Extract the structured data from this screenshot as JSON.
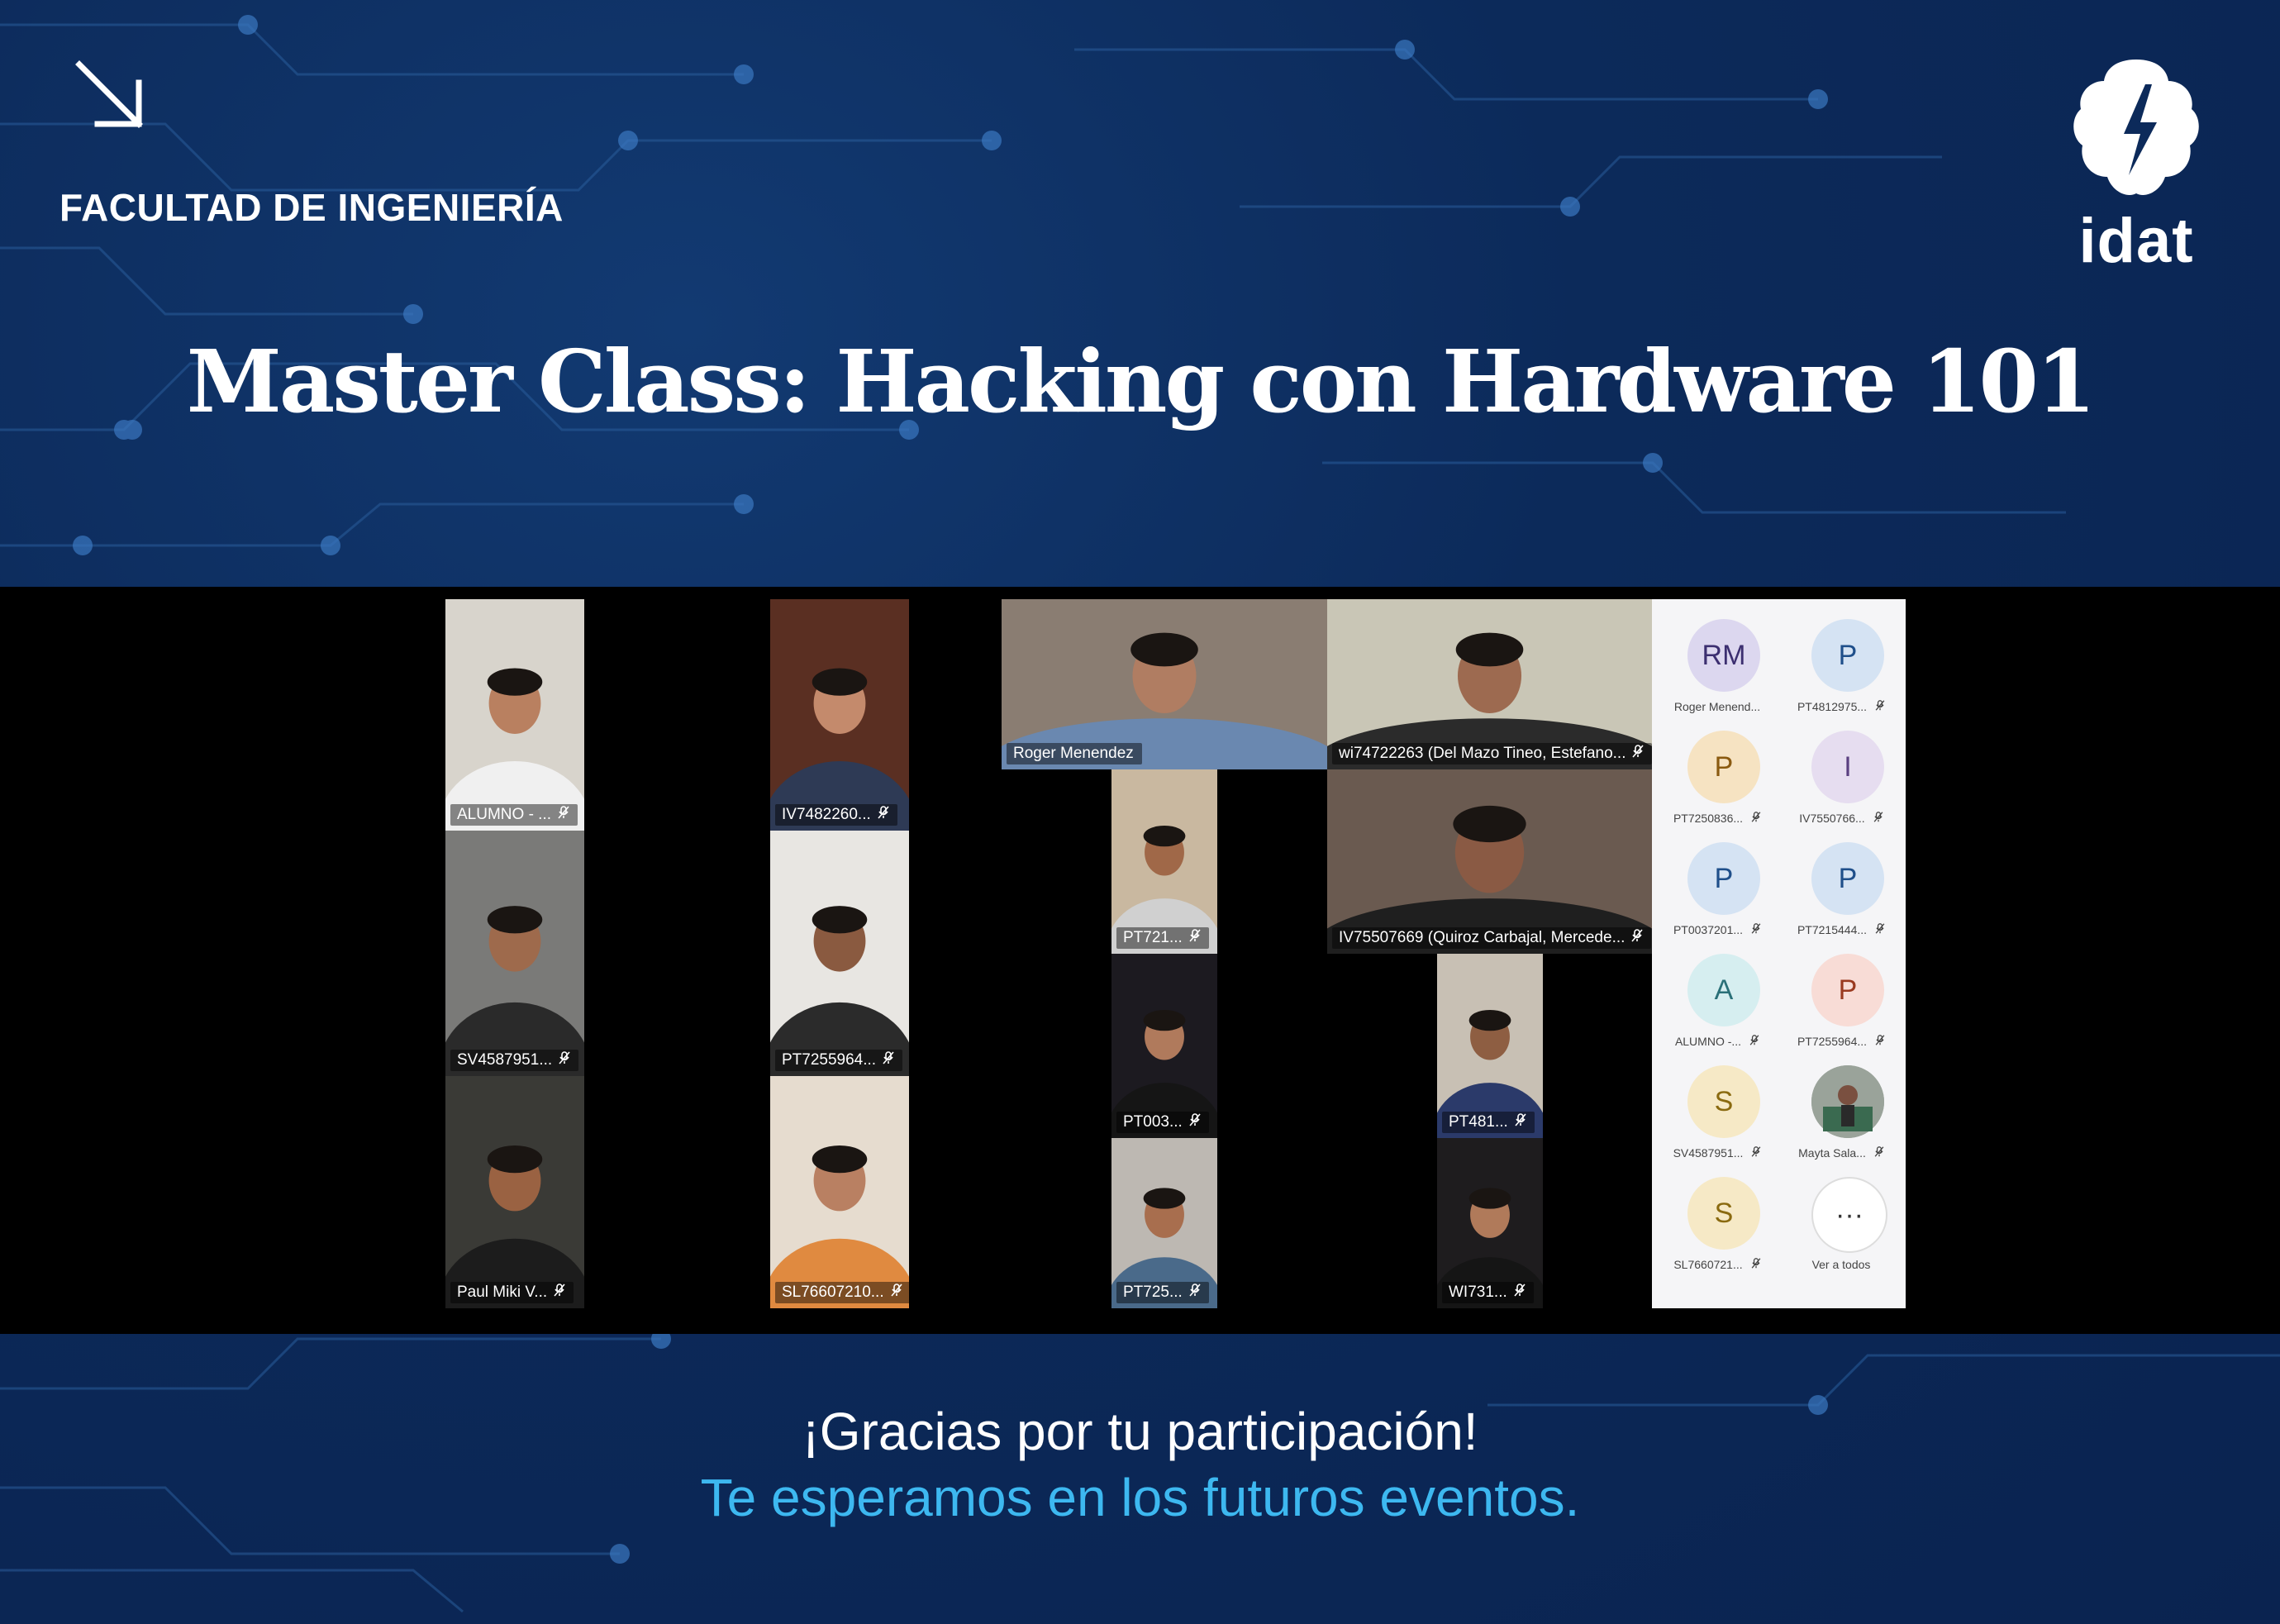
{
  "header": {
    "faculty": "FACULTAD DE INGENIERÍA",
    "brand": "idat",
    "title": "Master Class: Hacking con Hardware 101"
  },
  "meeting": {
    "tiles": [
      {
        "label": "ALUMNO - ...",
        "muted": true,
        "bg": "#d8d4cc",
        "skin": "#b98060",
        "shirt": "#f0f0f0"
      },
      {
        "label": "IV7482260...",
        "muted": true,
        "bg": "#5a2f22",
        "skin": "#c48a6c",
        "shirt": "#2e3a55"
      },
      {
        "label": "Roger Menendez",
        "muted": false,
        "bg": "#8a7d72",
        "skin": "#b07d62",
        "shirt": "#6a88b0"
      },
      {
        "label": "wi74722263 (Del Mazo Tineo, Estefano...",
        "muted": true,
        "bg": "#c9c6b6",
        "skin": "#9d6a50",
        "shirt": "#2b2b2b"
      },
      {
        "label": "PT721...",
        "muted": true,
        "bg": "#c9b8a0",
        "skin": "#a06848",
        "shirt": "#d0d0d0"
      },
      {
        "label": "IV75507669 (Quiroz Carbajal, Mercede...",
        "muted": true,
        "bg": "#6a5a50",
        "skin": "#8a5a44",
        "shirt": "#1f1f1f"
      },
      {
        "label": "SV4587951...",
        "muted": true,
        "bg": "#7a7a78",
        "skin": "#9e6a4c",
        "shirt": "#2a2a2a"
      },
      {
        "label": "PT7255964...",
        "muted": true,
        "bg": "#e8e6e2",
        "skin": "#8a5a40",
        "shirt": "#2b2b2b"
      },
      {
        "label": "PT003...",
        "muted": true,
        "bg": "#1c1a20",
        "skin": "#b07a5c",
        "shirt": "#151515"
      },
      {
        "label": "PT481...",
        "muted": true,
        "bg": "#c8c0b4",
        "skin": "#8e5e42",
        "shirt": "#2b3a6a"
      },
      {
        "label": "Paul Miki V...",
        "muted": true,
        "bg": "#3a3a36",
        "skin": "#9a6242",
        "shirt": "#1c1c1c"
      },
      {
        "label": "SL76607210...",
        "muted": true,
        "bg": "#e6dccf",
        "skin": "#b98062",
        "shirt": "#e08a40"
      },
      {
        "label": "PT725...",
        "muted": true,
        "bg": "#bdb8b2",
        "skin": "#a86e4e",
        "shirt": "#4a6a8a"
      },
      {
        "label": "WI731...",
        "muted": true,
        "bg": "#1e1c1e",
        "skin": "#b07a5a",
        "shirt": "#151515"
      }
    ],
    "participants": [
      {
        "initials": "RM",
        "name": "Roger Menend...",
        "muted": false,
        "bg": "#dcd7ef",
        "fg": "#3c2f70"
      },
      {
        "initials": "P",
        "name": "PT4812975...",
        "muted": true,
        "bg": "#d5e3f3",
        "fg": "#1f4f8a"
      },
      {
        "initials": "P",
        "name": "PT7250836...",
        "muted": true,
        "bg": "#f6e3c2",
        "fg": "#8a5a10"
      },
      {
        "initials": "I",
        "name": "IV7550766...",
        "muted": true,
        "bg": "#e6ddf0",
        "fg": "#5a3f80"
      },
      {
        "initials": "P",
        "name": "PT0037201...",
        "muted": true,
        "bg": "#d5e3f3",
        "fg": "#1f4f8a"
      },
      {
        "initials": "P",
        "name": "PT7215444...",
        "muted": true,
        "bg": "#d5e3f3",
        "fg": "#1f4f8a"
      },
      {
        "initials": "A",
        "name": "ALUMNO -...",
        "muted": true,
        "bg": "#d6eef0",
        "fg": "#2a7078"
      },
      {
        "initials": "P",
        "name": "PT7255964...",
        "muted": true,
        "bg": "#f8dcd6",
        "fg": "#9a3a20"
      },
      {
        "initials": "S",
        "name": "SV4587951...",
        "muted": true,
        "bg": "#f6e9c6",
        "fg": "#8a6a10"
      },
      {
        "initials": "",
        "name": "Mayta Sala...",
        "muted": true,
        "bg": "#9aa39a",
        "fg": "#ffffff"
      },
      {
        "initials": "S",
        "name": "SL7660721...",
        "muted": true,
        "bg": "#f6e9c6",
        "fg": "#8a6a10"
      },
      {
        "initials": "···",
        "name": "Ver a todos",
        "muted": false,
        "bg": "#ffffff",
        "fg": "#333333"
      }
    ]
  },
  "footer": {
    "thanks": "¡Gracias por tu participación!",
    "invite": "Te esperamos en los futuros eventos."
  }
}
